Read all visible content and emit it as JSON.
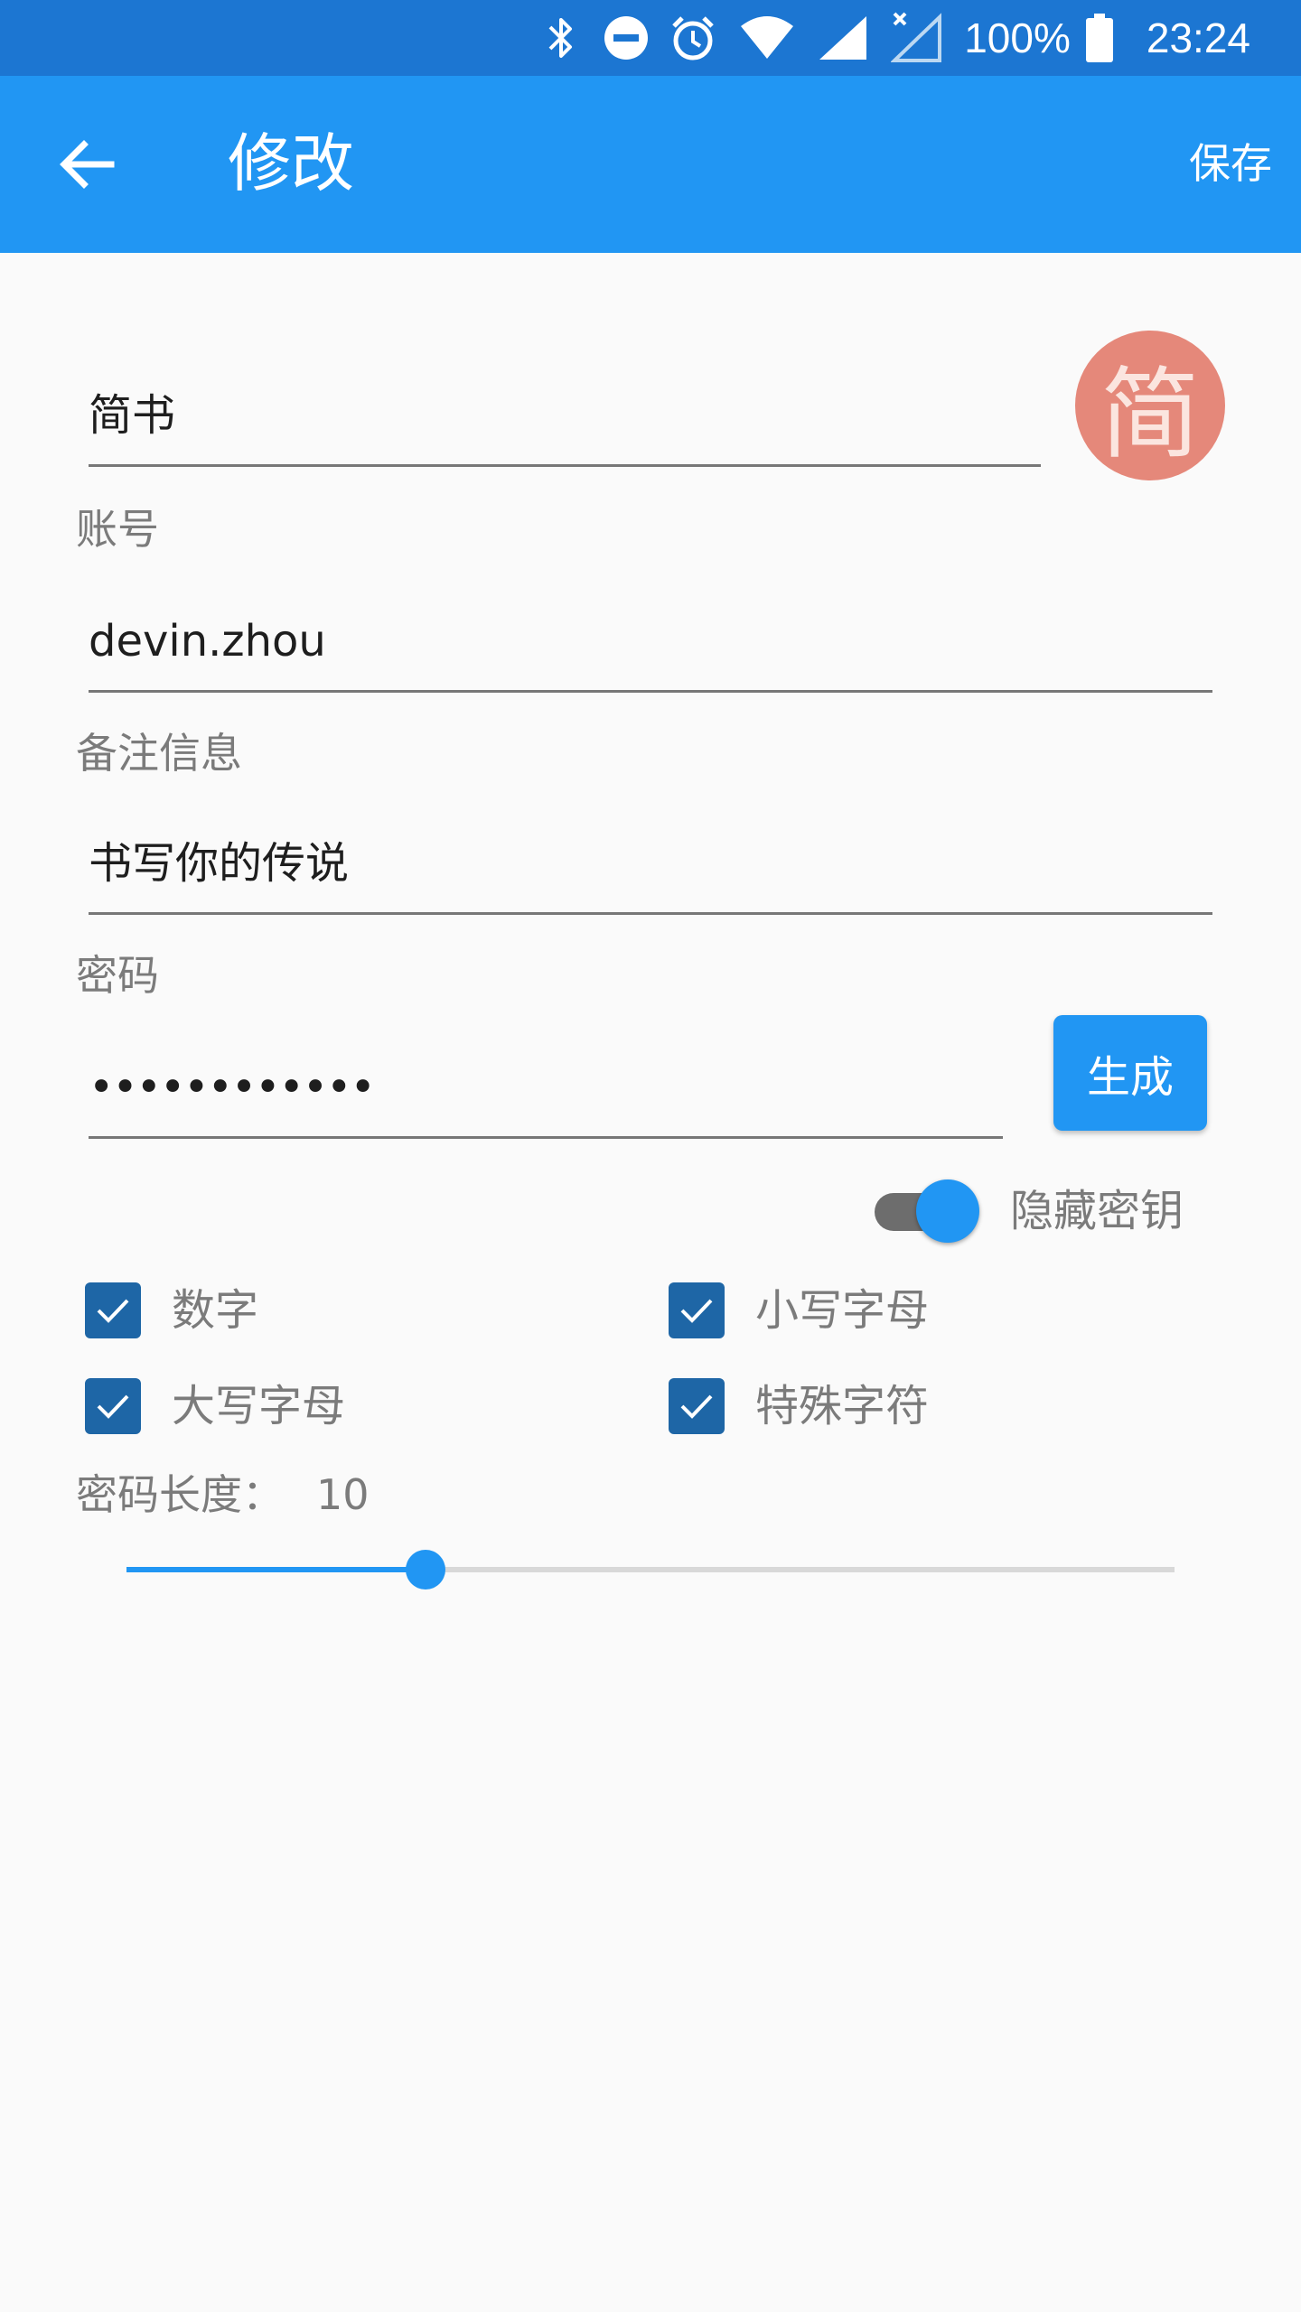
{
  "status_bar": {
    "battery_percent": "100%",
    "time": "23:24"
  },
  "app_bar": {
    "title": "修改",
    "save_label": "保存"
  },
  "form": {
    "name_value": "简书",
    "avatar_char": "简",
    "account_label": "账号",
    "account_value": "devin.zhou",
    "note_label": "备注信息",
    "note_value": "书写你的传说",
    "password_label": "密码",
    "password_value": "••••••••••••",
    "generate_label": "生成",
    "hide_key_label": "隐藏密钥",
    "hide_key_on": true
  },
  "options": [
    {
      "label": "数字",
      "checked": true
    },
    {
      "label": "小写字母",
      "checked": true
    },
    {
      "label": "大写字母",
      "checked": true
    },
    {
      "label": "特殊字符",
      "checked": true
    }
  ],
  "length": {
    "label": "密码长度：",
    "value": "10",
    "fraction": 0.285
  },
  "colors": {
    "primary": "#2196f3",
    "status_bar": "#1c76d2",
    "avatar": "#e5887a",
    "checkbox": "#1e66a6"
  }
}
